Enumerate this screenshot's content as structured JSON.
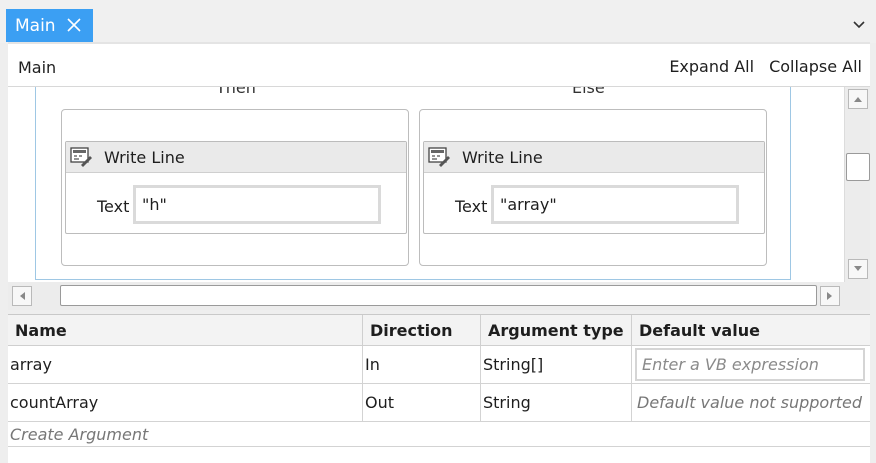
{
  "tabs": [
    {
      "label": "Main",
      "active": true
    }
  ],
  "header": {
    "breadcrumb": "Main",
    "expand_all": "Expand All",
    "collapse_all": "Collapse All"
  },
  "if_activity": {
    "then_label": "Then",
    "else_label": "Else",
    "then_activity": {
      "title": "Write Line",
      "field_label": "Text",
      "field_value": "\"h\""
    },
    "else_activity": {
      "title": "Write Line",
      "field_label": "Text",
      "field_value": "\"array\""
    }
  },
  "arguments": {
    "columns": [
      "Name",
      "Direction",
      "Argument type",
      "Default value"
    ],
    "rows": [
      {
        "name": "array",
        "direction": "In",
        "type": "String[]",
        "default_placeholder": "Enter a VB expression"
      },
      {
        "name": "countArray",
        "direction": "Out",
        "type": "String",
        "default_text": "Default value not supported"
      }
    ],
    "create_label": "Create Argument"
  },
  "colors": {
    "tab_active": "#3b9ff3",
    "if_border": "#9ec7e4"
  }
}
